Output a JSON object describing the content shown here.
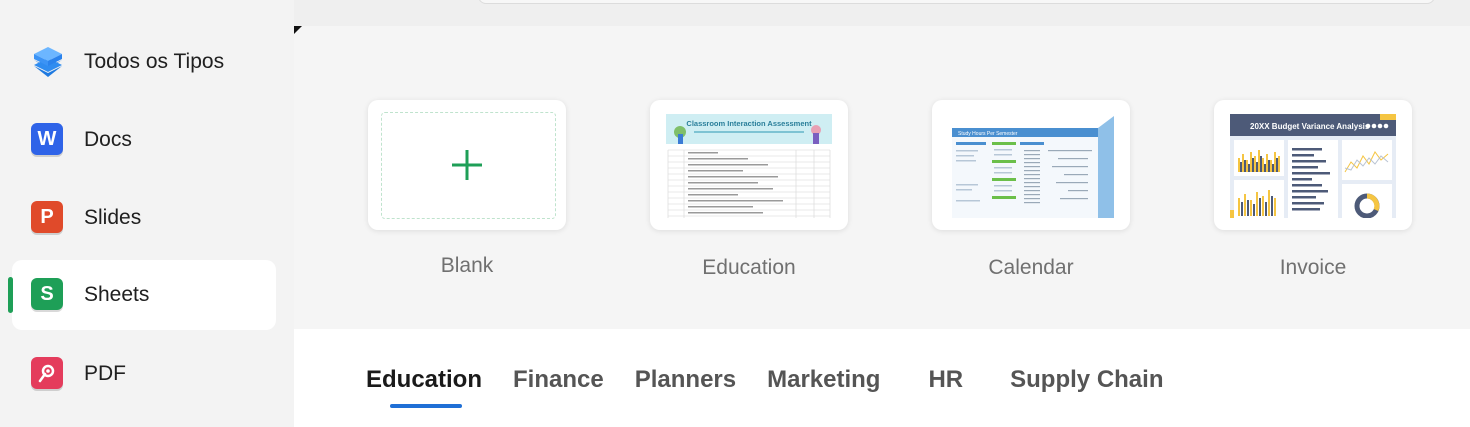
{
  "sidebar": {
    "items": [
      {
        "label": "Todos os Tipos",
        "icon": "layers-icon",
        "color": "#2f8cf0",
        "active": false
      },
      {
        "label": "Docs",
        "icon": "word-icon",
        "letter": "W",
        "color": "#2e63e8",
        "active": false
      },
      {
        "label": "Slides",
        "icon": "powerpoint-icon",
        "letter": "P",
        "color": "#e04a2a",
        "active": false
      },
      {
        "label": "Sheets",
        "icon": "sheets-icon",
        "letter": "S",
        "color": "#1e9f57",
        "active": true
      },
      {
        "label": "PDF",
        "icon": "pdf-icon",
        "color": "#e43c5c",
        "active": false
      }
    ]
  },
  "templates": [
    {
      "label": "Blank",
      "kind": "blank"
    },
    {
      "label": "Education",
      "kind": "education",
      "thumb_title": "Classroom Interaction Assessment"
    },
    {
      "label": "Calendar",
      "kind": "calendar",
      "thumb_title": "Study Hours Per Semester"
    },
    {
      "label": "Invoice",
      "kind": "invoice",
      "thumb_title": "20XX Budget Variance Analysis"
    }
  ],
  "categories": {
    "tabs": [
      "Education",
      "Finance",
      "Planners",
      "Marketing",
      "HR",
      "Supply Chain"
    ],
    "active": "Education"
  },
  "colors": {
    "accent_green": "#1e9f57",
    "accent_blue": "#1f6fd6"
  }
}
